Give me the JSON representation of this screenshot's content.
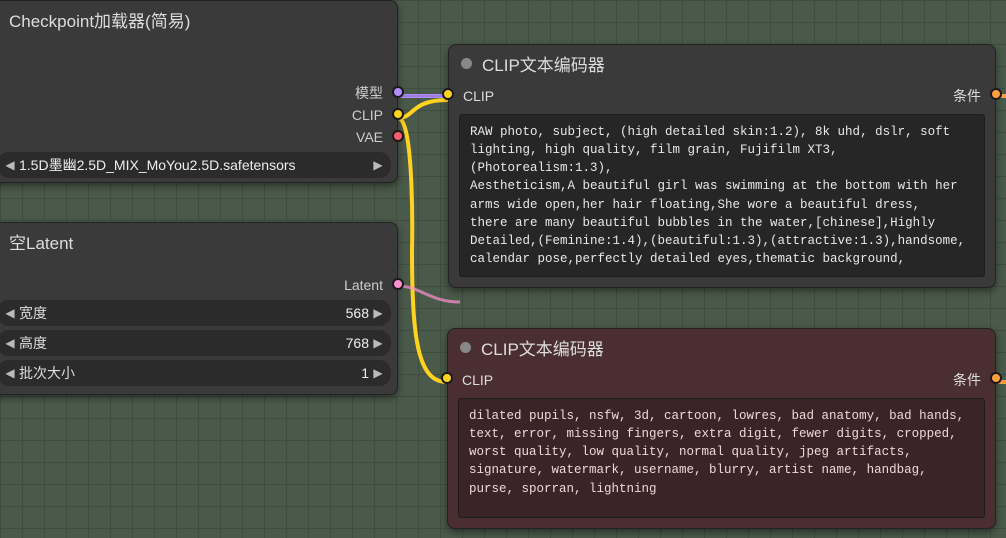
{
  "checkpoint_node": {
    "title": "Checkpoint加载器(简易)",
    "outputs": {
      "model": "模型",
      "clip": "CLIP",
      "vae": "VAE"
    },
    "ckpt_value": "1.5D墨幽2.5D_MIX_MoYou2.5D.safetensors"
  },
  "latent_node": {
    "title": "空Latent",
    "output": "Latent",
    "width_label": "宽度",
    "width_value": "568",
    "height_label": "高度",
    "height_value": "768",
    "batch_label": "批次大小",
    "batch_value": "1"
  },
  "pos_node": {
    "title": "CLIP文本编码器",
    "clip_label": "CLIP",
    "cond_label": "条件",
    "text": "RAW photo, subject, (high detailed skin:1.2), 8k uhd, dslr, soft lighting, high quality, film grain, Fujifilm XT3,(Photorealism:1.3),\nAestheticism,A beautiful girl was swimming at the bottom with her arms wide open,her hair floating,She wore a beautiful dress,\nthere are many beautiful bubbles in the water,[chinese],Highly Detailed,(Feminine:1.4),(beautiful:1.3),(attractive:1.3),handsome,\ncalendar pose,perfectly detailed eyes,thematic background,"
  },
  "neg_node": {
    "title": "CLIP文本编码器",
    "clip_label": "CLIP",
    "cond_label": "条件",
    "text": "dilated pupils, nsfw, 3d, cartoon, lowres, bad anatomy, bad hands, text, error, missing fingers, extra digit, fewer digits, cropped, worst quality, low quality, normal quality, jpeg artifacts, signature, watermark, username, blurry, artist name, handbag, purse, sporran, lightning"
  }
}
